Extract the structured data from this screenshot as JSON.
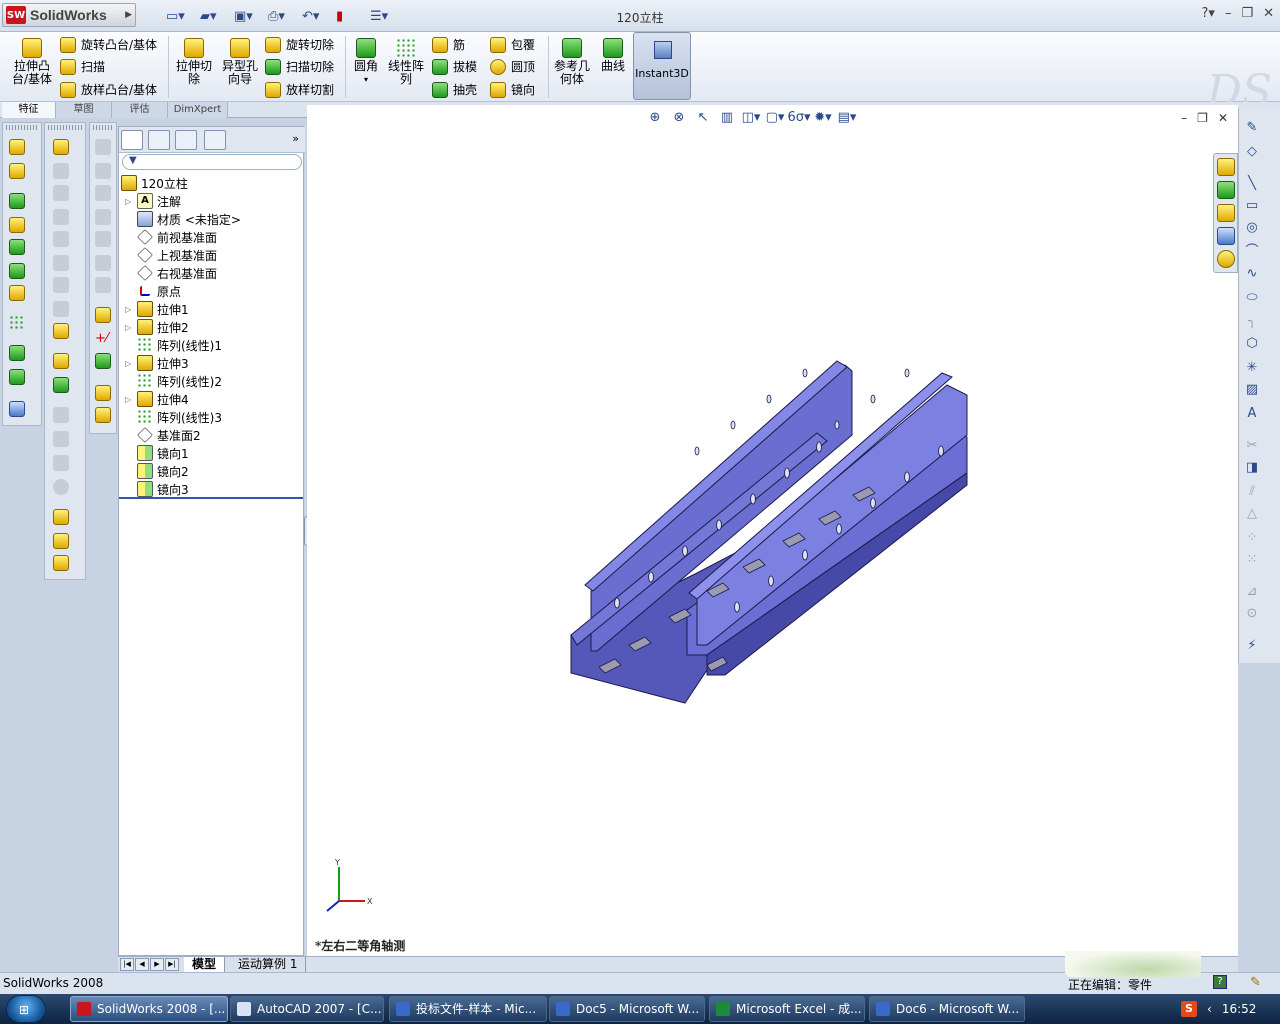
{
  "app": {
    "brand": "SolidWorks",
    "document_title": "120立柱",
    "colors": {
      "accent": "#2a5ab0",
      "model": "#6366cc",
      "brand_red": "#c8161d"
    }
  },
  "ribbon": {
    "extrude_boss": "拉伸凸\n台/基体",
    "revolve_boss": "旋转凸台/基体",
    "sweep": "扫描",
    "loft_boss": "放样凸台/基体",
    "extrude_cut": "拉伸切\n除",
    "hole_wizard": "异型孔\n向导",
    "revolve_cut": "旋转切除",
    "sweep_cut": "扫描切除",
    "loft_cut": "放样切割",
    "fillet": "圆角",
    "linear_pattern": "线性阵\n列",
    "rib": "筋",
    "draft": "拔模",
    "shell": "抽壳",
    "wrap": "包覆",
    "dome": "圆顶",
    "mirror": "镜向",
    "ref_geometry": "参考几\n何体",
    "curves": "曲线",
    "instant3d": "Instant3D"
  },
  "tabs": [
    "特征",
    "草图",
    "评估",
    "DimXpert"
  ],
  "tree": {
    "root": "120立柱",
    "items": [
      {
        "label": "注解",
        "icon": "note-icon",
        "exp": "▷"
      },
      {
        "label": "材质 <未指定>",
        "icon": "material-icon",
        "exp": ""
      },
      {
        "label": "前视基准面",
        "icon": "plane-icon",
        "exp": ""
      },
      {
        "label": "上视基准面",
        "icon": "plane-icon",
        "exp": ""
      },
      {
        "label": "右视基准面",
        "icon": "plane-icon",
        "exp": ""
      },
      {
        "label": "原点",
        "icon": "origin-icon",
        "exp": ""
      },
      {
        "label": "拉伸1",
        "icon": "extrude-icon",
        "exp": "▷"
      },
      {
        "label": "拉伸2",
        "icon": "extrude-icon",
        "exp": "▷"
      },
      {
        "label": "阵列(线性)1",
        "icon": "pattern-icon",
        "exp": ""
      },
      {
        "label": "拉伸3",
        "icon": "extrude-icon",
        "exp": "▷"
      },
      {
        "label": "阵列(线性)2",
        "icon": "pattern-icon",
        "exp": ""
      },
      {
        "label": "拉伸4",
        "icon": "extrude-icon",
        "exp": "▷"
      },
      {
        "label": "阵列(线性)3",
        "icon": "pattern-icon",
        "exp": ""
      },
      {
        "label": "基准面2",
        "icon": "plane-icon",
        "exp": ""
      },
      {
        "label": "镜向1",
        "icon": "mirror-icon",
        "exp": ""
      },
      {
        "label": "镜向2",
        "icon": "mirror-icon",
        "exp": ""
      },
      {
        "label": "镜向3",
        "icon": "mirror-icon",
        "exp": ""
      }
    ]
  },
  "bottom_tabs": {
    "model": "模型",
    "motion": "运动算例 1"
  },
  "viewport": {
    "view_label": "*左右二等角轴测",
    "axis_x": "X",
    "axis_y": "Y"
  },
  "status": {
    "left": "SolidWorks 2008",
    "right": "正在编辑：零件",
    "help": "?"
  },
  "taskbar": {
    "start": "⊞",
    "items": [
      "SolidWorks 2008 - [...",
      "AutoCAD 2007 - [C...",
      "投标文件-样本 - Mic...",
      "Doc5 - Microsoft W...",
      "Microsoft Excel - 成...",
      "Doc6 - Microsoft W..."
    ],
    "tray_s": "S",
    "tray_arrow": "‹",
    "clock": "16:52"
  }
}
